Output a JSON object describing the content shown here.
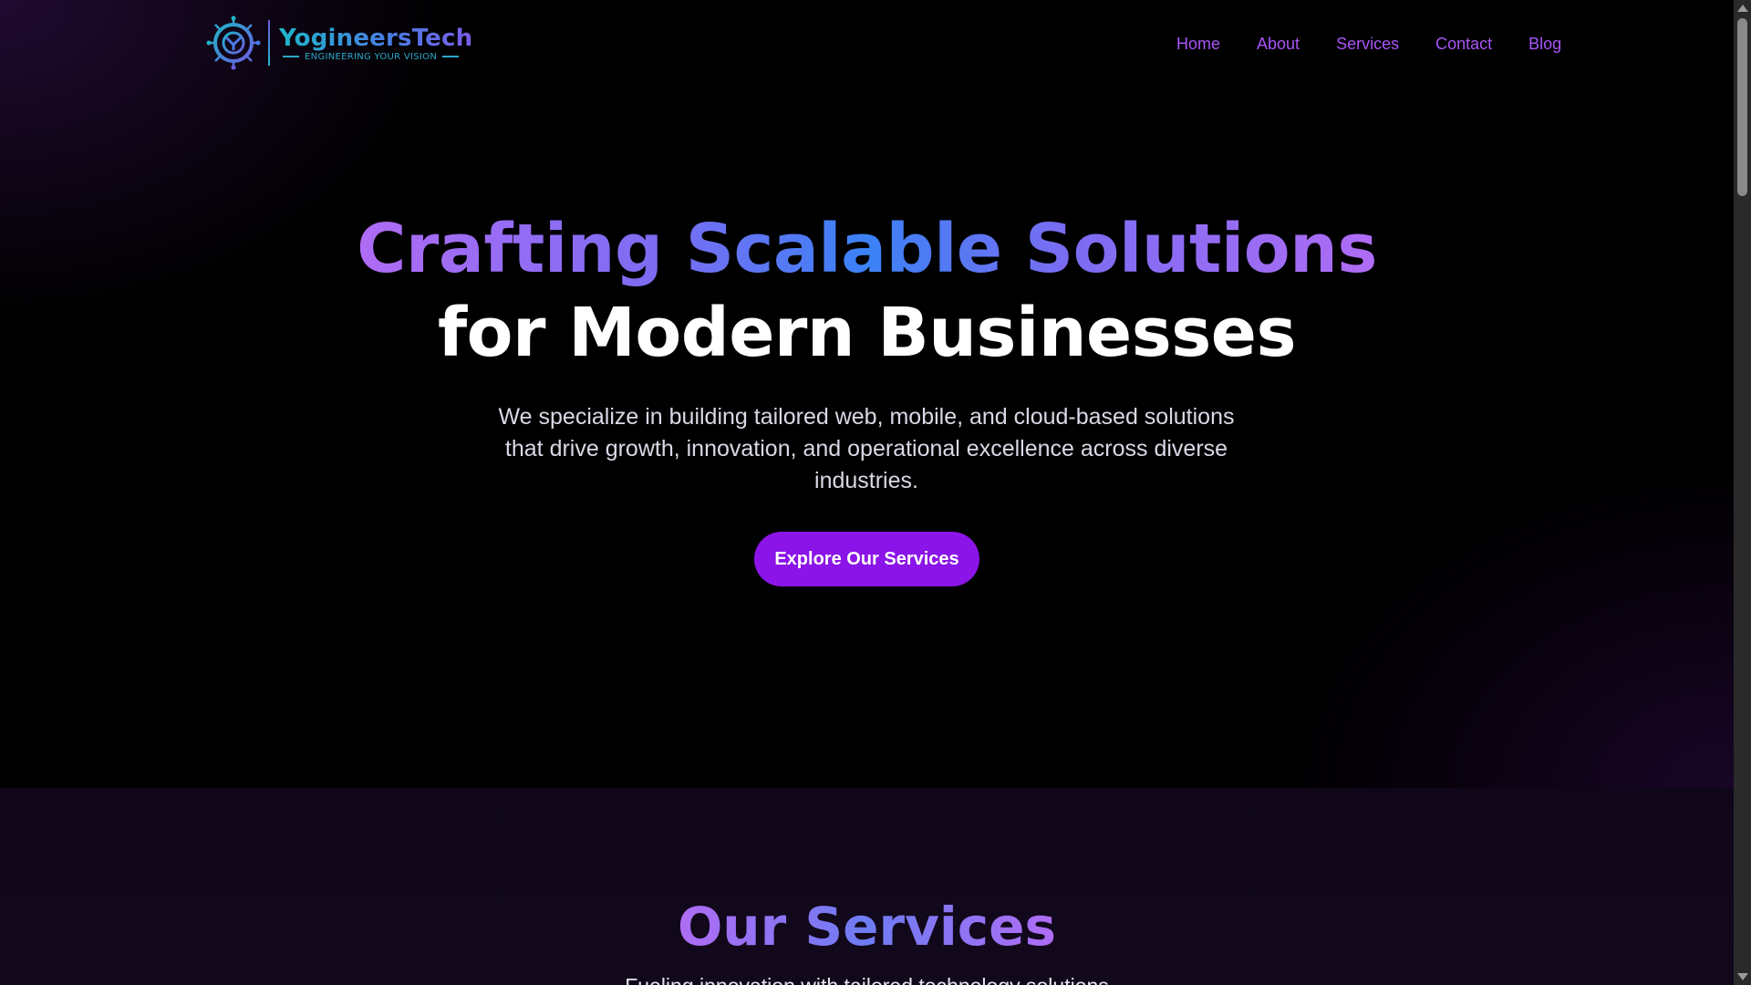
{
  "brand": {
    "name": "YogineersTech",
    "tagline": "ENGINEERING YOUR VISION"
  },
  "nav": {
    "items": [
      {
        "label": "Home"
      },
      {
        "label": "About"
      },
      {
        "label": "Services"
      },
      {
        "label": "Contact"
      },
      {
        "label": "Blog"
      }
    ]
  },
  "hero": {
    "headline_gradient": "Crafting Scalable Solutions",
    "headline_white": "for Modern Businesses",
    "description": "We specialize in building tailored web, mobile, and cloud-based solutions that drive growth, innovation, and operational excellence across diverse industries.",
    "cta_label": "Explore Our Services"
  },
  "services": {
    "title": "Our Services",
    "subtitle": "Fueling innovation with tailored technology solutions"
  },
  "colors": {
    "accent": "#8b14e8",
    "nav_link": "#a855f7",
    "gradient_purple": "#b06cf5",
    "gradient_blue": "#3b82f6"
  }
}
